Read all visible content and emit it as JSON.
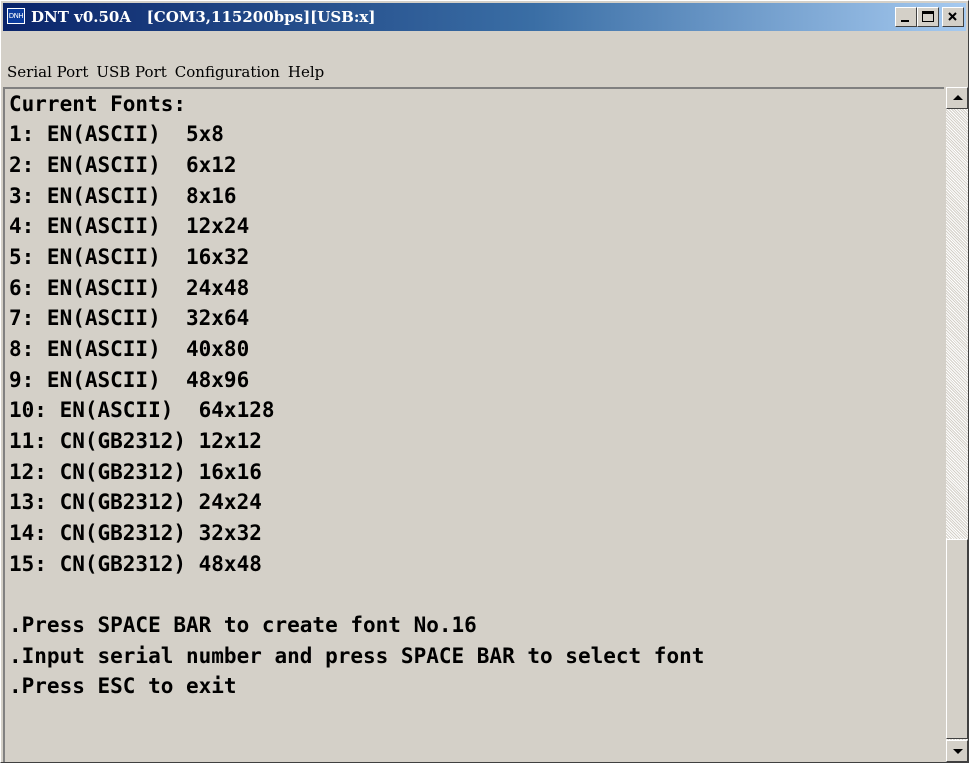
{
  "window": {
    "app_icon_label": "DNH",
    "title": "DNT v0.50A   [COM3,115200bps][USB:x]"
  },
  "menubar": {
    "items": [
      "Serial Port",
      "USB Port",
      "Configuration",
      "Help"
    ]
  },
  "terminal": {
    "lines": [
      "Current Fonts:",
      "1: EN(ASCII)  5x8",
      "2: EN(ASCII)  6x12",
      "3: EN(ASCII)  8x16",
      "4: EN(ASCII)  12x24",
      "5: EN(ASCII)  16x32",
      "6: EN(ASCII)  24x48",
      "7: EN(ASCII)  32x64",
      "8: EN(ASCII)  40x80",
      "9: EN(ASCII)  48x96",
      "10: EN(ASCII)  64x128",
      "11: CN(GB2312) 12x12",
      "12: CN(GB2312) 16x16",
      "13: CN(GB2312) 24x24",
      "14: CN(GB2312) 32x32",
      "15: CN(GB2312) 48x48",
      "",
      ".Press SPACE BAR to create font No.16",
      ".Input serial number and press SPACE BAR to select font",
      ".Press ESC to exit"
    ]
  },
  "scrollbar": {
    "position_fraction": 1.0
  },
  "colors": {
    "window_face": "#d4d0c8",
    "title_gradient_start": "#0a246a",
    "title_gradient_end": "#a6caf0",
    "text": "#000000"
  }
}
